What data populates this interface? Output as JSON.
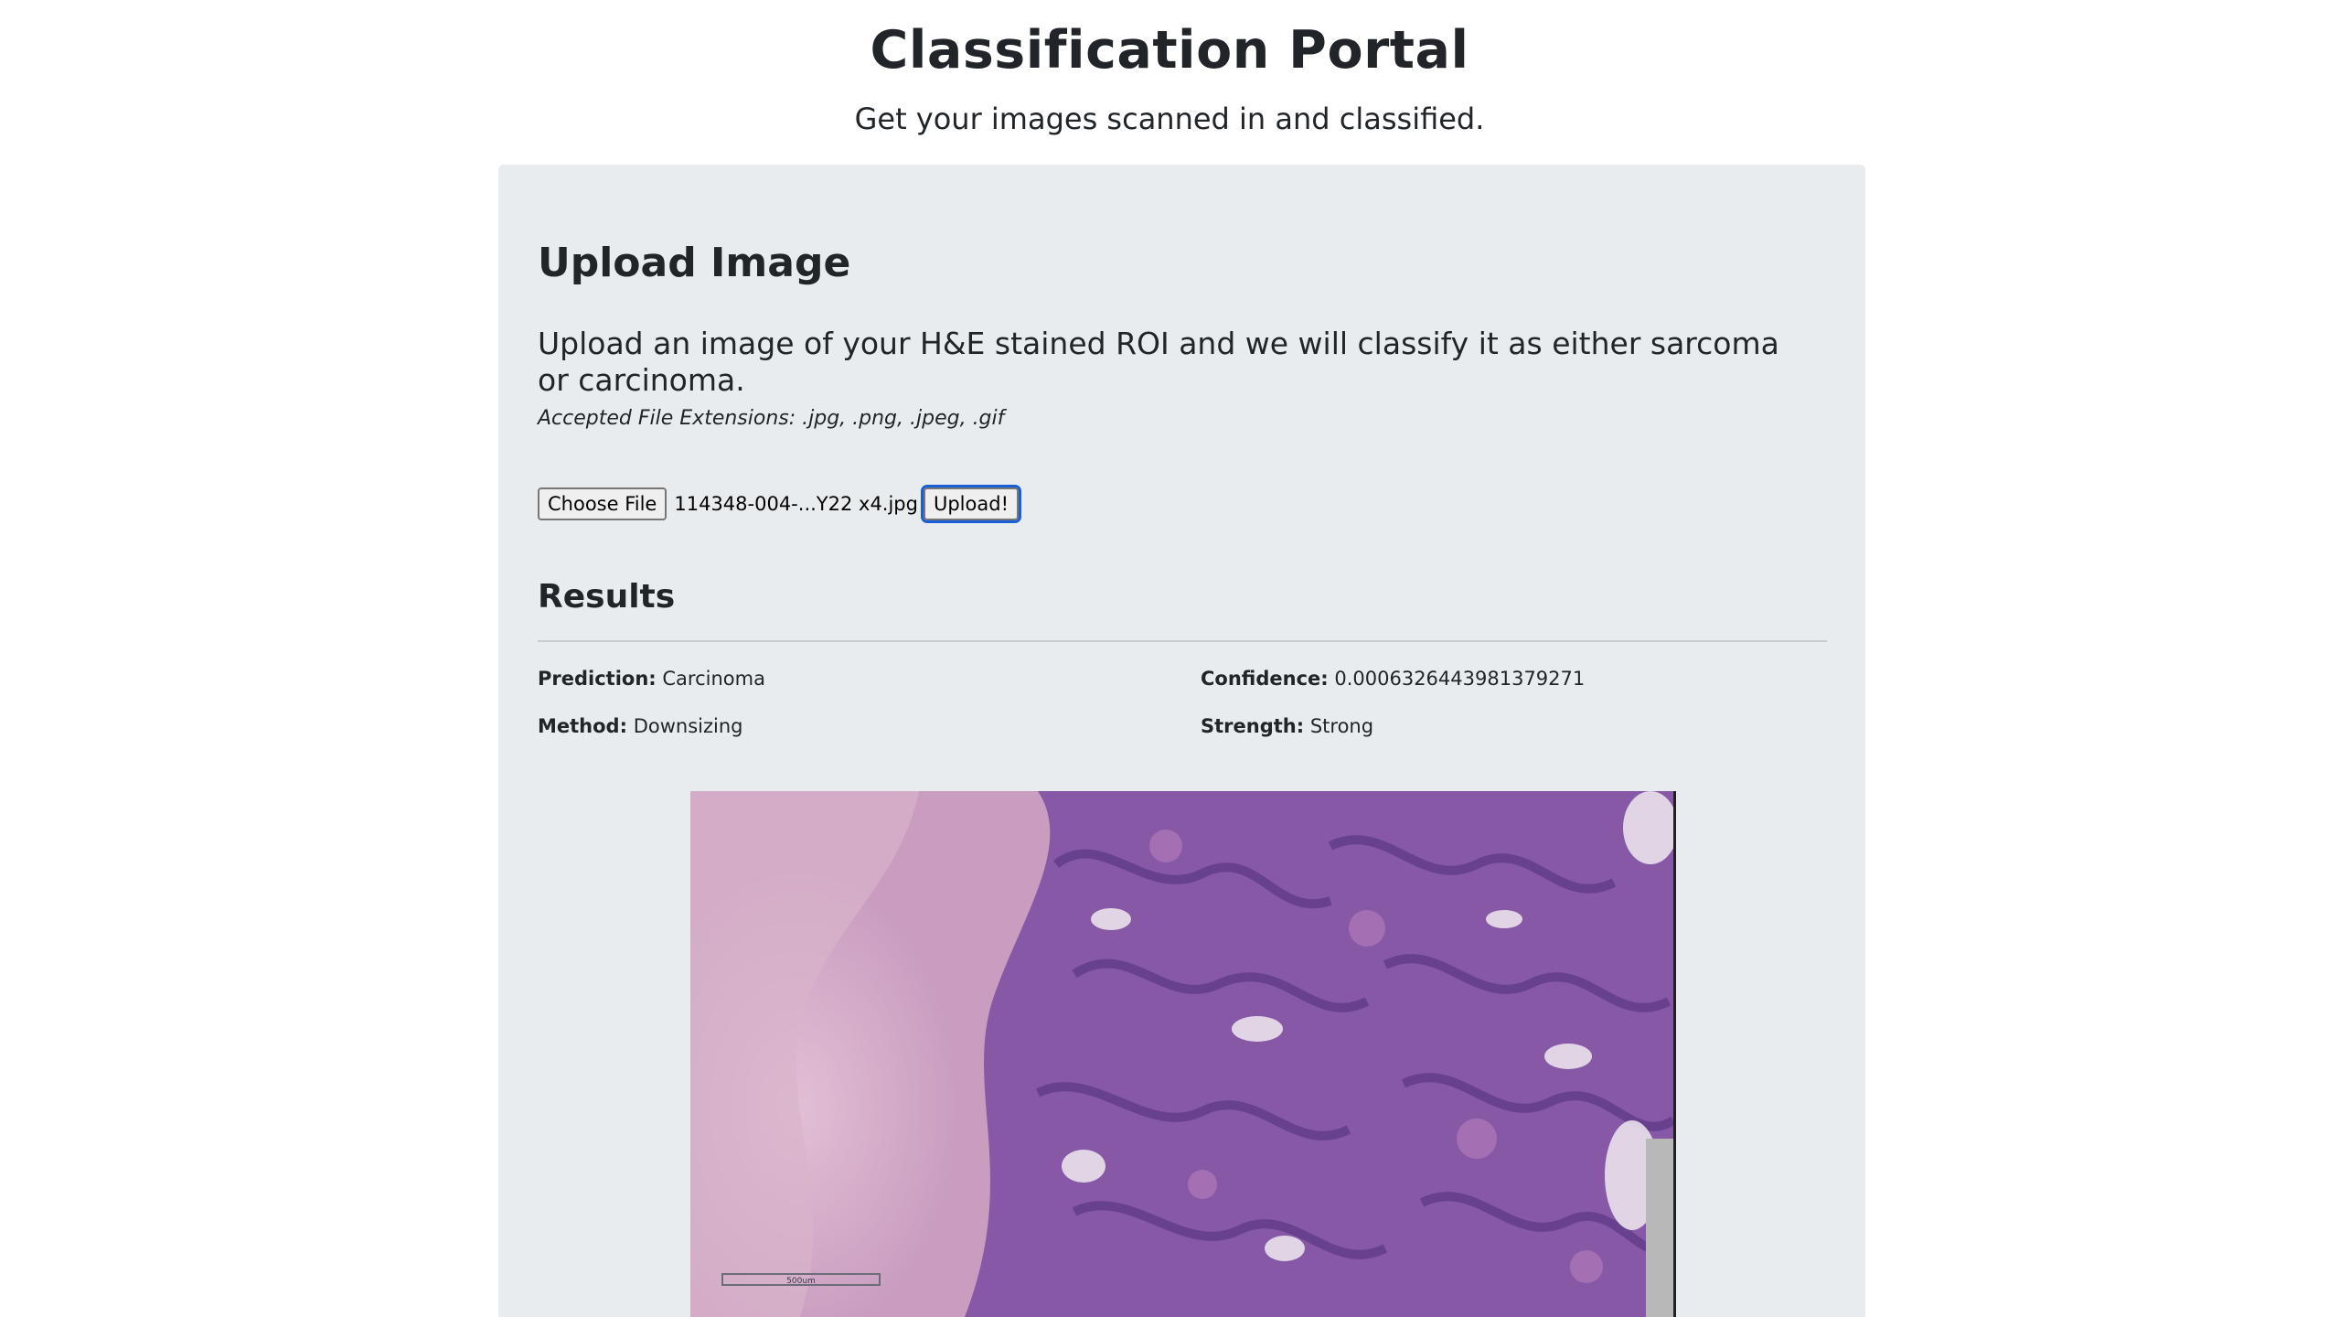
{
  "header": {
    "title": "Classification Portal",
    "subtitle": "Get your images scanned in and classified."
  },
  "upload": {
    "title": "Upload Image",
    "description": "Upload an image of your H&E stained ROI and we will classify it as either sarcoma or carcinoma.",
    "extensions": "Accepted File Extensions: .jpg, .png, .jpeg, .gif",
    "choose_label": "Choose File",
    "filename": "114348-004-...Y22 x4.jpg",
    "upload_label": "Upload!"
  },
  "results": {
    "title": "Results",
    "prediction_label": "Prediction:",
    "prediction_value": "Carcinoma",
    "confidence_label": "Confidence:",
    "confidence_value": "0.0006326443981379271",
    "method_label": "Method:",
    "method_value": "Downsizing",
    "strength_label": "Strength:",
    "strength_value": "Strong"
  },
  "image": {
    "scale_bar_text": "500um"
  },
  "colors": {
    "card_background": "#e9ecef",
    "focus_ring": "#1a5fd6",
    "stain_purple": "#8a5aa8",
    "stain_pink": "#d9aec8"
  }
}
